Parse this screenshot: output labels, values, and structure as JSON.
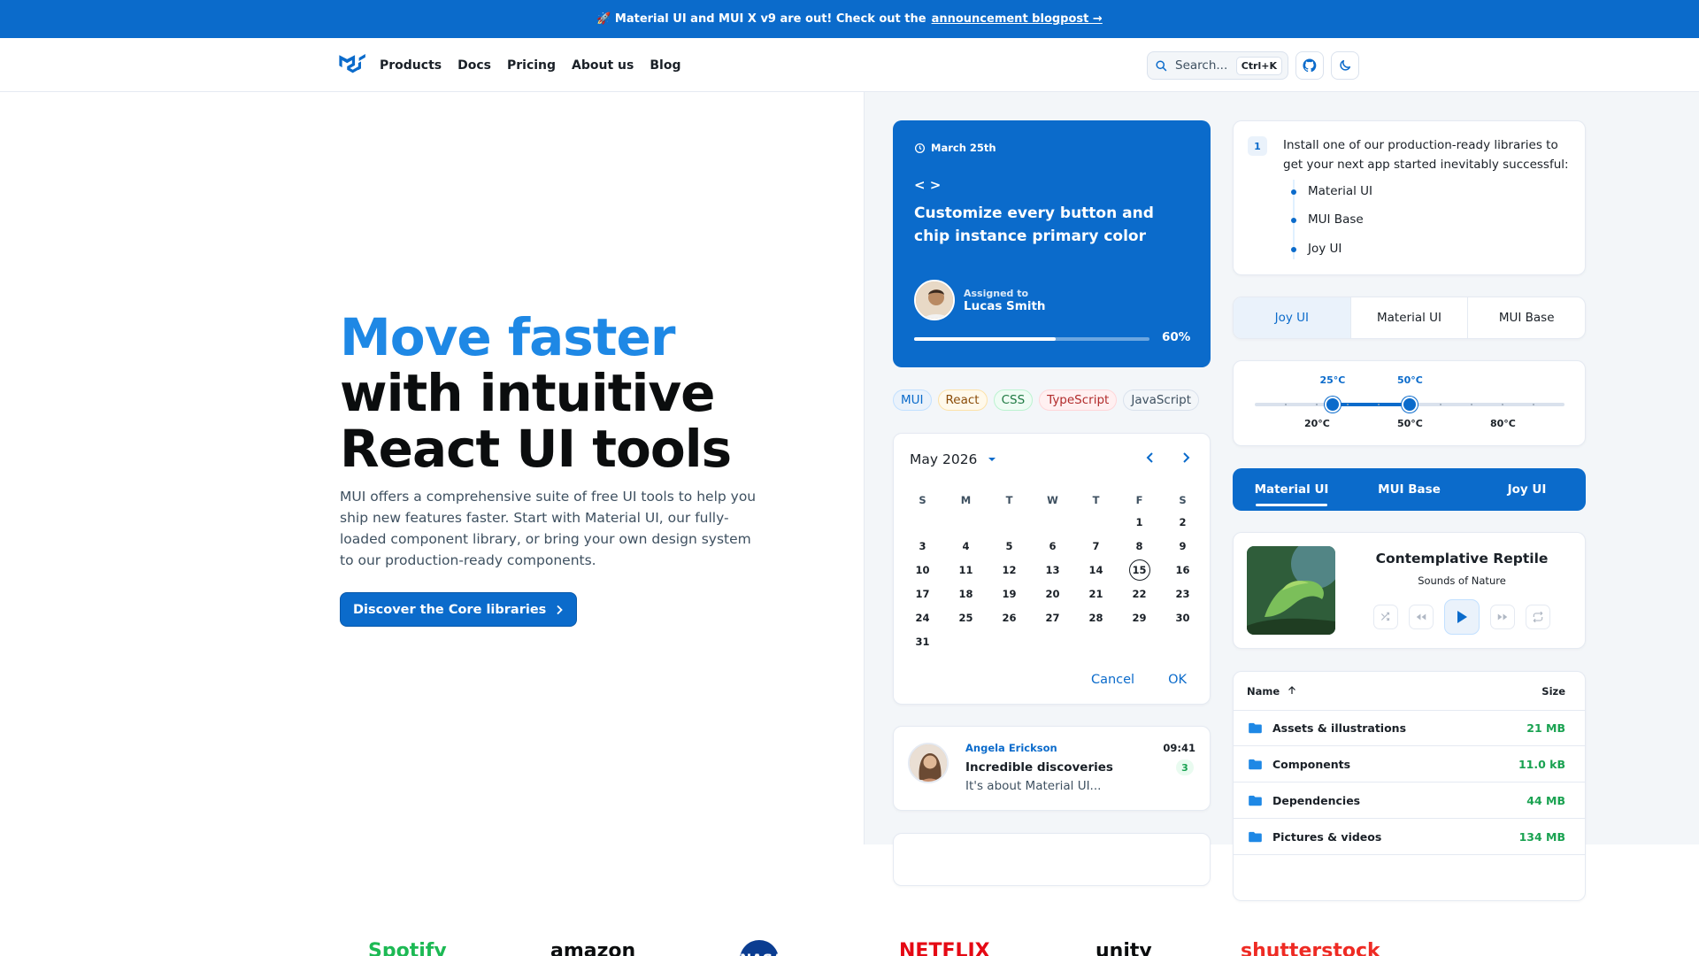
{
  "banner": {
    "text": "🚀 Material UI and MUI X v9 are out! Check out the",
    "link": "announcement blogpost →"
  },
  "nav": {
    "items": [
      "Products",
      "Docs",
      "Pricing",
      "About us",
      "Blog"
    ]
  },
  "search": {
    "placeholder": "Search...",
    "shortcut": "Ctrl+K"
  },
  "hero": {
    "title_highlight": "Move faster",
    "title_line2": "with intuitive",
    "title_line3": "React UI tools",
    "description": "MUI offers a comprehensive suite of free UI tools to help you ship new features faster. Start with Material UI, our fully-loaded component library, or bring your own design system to our production-ready components.",
    "cta": "Discover the Core libraries"
  },
  "task": {
    "date": "March 25th",
    "code_glyph": "< >",
    "title": "Customize every button and chip instance primary color",
    "assigned_label": "Assigned to",
    "assignee": "Lucas Smith",
    "progress": 0.6,
    "progress_label": "60%"
  },
  "chips": [
    {
      "label": "MUI",
      "color": "#0b6bcb",
      "bg": "#eaf2fb",
      "border": "#c2e0ff"
    },
    {
      "label": "React",
      "color": "#8a4b08",
      "bg": "#fff9eb",
      "border": "#fce2a9"
    },
    {
      "label": "CSS",
      "color": "#1f7a43",
      "bg": "#effcf4",
      "border": "#bbf3d0"
    },
    {
      "label": "TypeScript",
      "color": "#b12b2b",
      "bg": "#fff0f1",
      "border": "#ffd6d9"
    },
    {
      "label": "JavaScript",
      "color": "#3e5060",
      "bg": "#f3f6f9",
      "border": "#dae2ed"
    }
  ],
  "calendar": {
    "month": "May 2026",
    "weekdays": [
      "S",
      "M",
      "T",
      "W",
      "T",
      "F",
      "S"
    ],
    "leading_blanks": 5,
    "days": 31,
    "selected": 15,
    "cancel": "Cancel",
    "ok": "OK"
  },
  "message": {
    "from": "Angela Erickson",
    "subject": "Incredible discoveries",
    "body": "It's about Material UI...",
    "time": "09:41",
    "count": "3"
  },
  "install": {
    "step": "1",
    "text": "Install one of our production-ready libraries to get your next app started inevitably successful:",
    "items": [
      "Material UI",
      "MUI Base",
      "Joy UI"
    ]
  },
  "segmented": {
    "options": [
      "Joy UI",
      "Material UI",
      "MUI Base"
    ],
    "active": 0
  },
  "slider": {
    "min": 0,
    "max": 100,
    "values": [
      25,
      50
    ],
    "value_labels": [
      "25°C",
      "50°C"
    ],
    "marks": [
      {
        "value": 20,
        "label": "20°C"
      },
      {
        "value": 50,
        "label": "50°C"
      },
      {
        "value": 80,
        "label": "80°C"
      }
    ]
  },
  "tabs": {
    "items": [
      "Material UI",
      "MUI Base",
      "Joy UI"
    ],
    "active": 0
  },
  "player": {
    "song": "Contemplative Reptile",
    "artist": "Sounds of Nature"
  },
  "files": {
    "col_name": "Name",
    "col_size": "Size",
    "rows": [
      {
        "name": "Assets & illustrations",
        "size": "21 MB"
      },
      {
        "name": "Components",
        "size": "11.0 kB"
      },
      {
        "name": "Dependencies",
        "size": "44 MB"
      },
      {
        "name": "Pictures & videos",
        "size": "134 MB"
      }
    ]
  },
  "logos": [
    "Spotify",
    "amazon",
    "NASA",
    "NETFLIX",
    "unity",
    "shutterstock"
  ]
}
